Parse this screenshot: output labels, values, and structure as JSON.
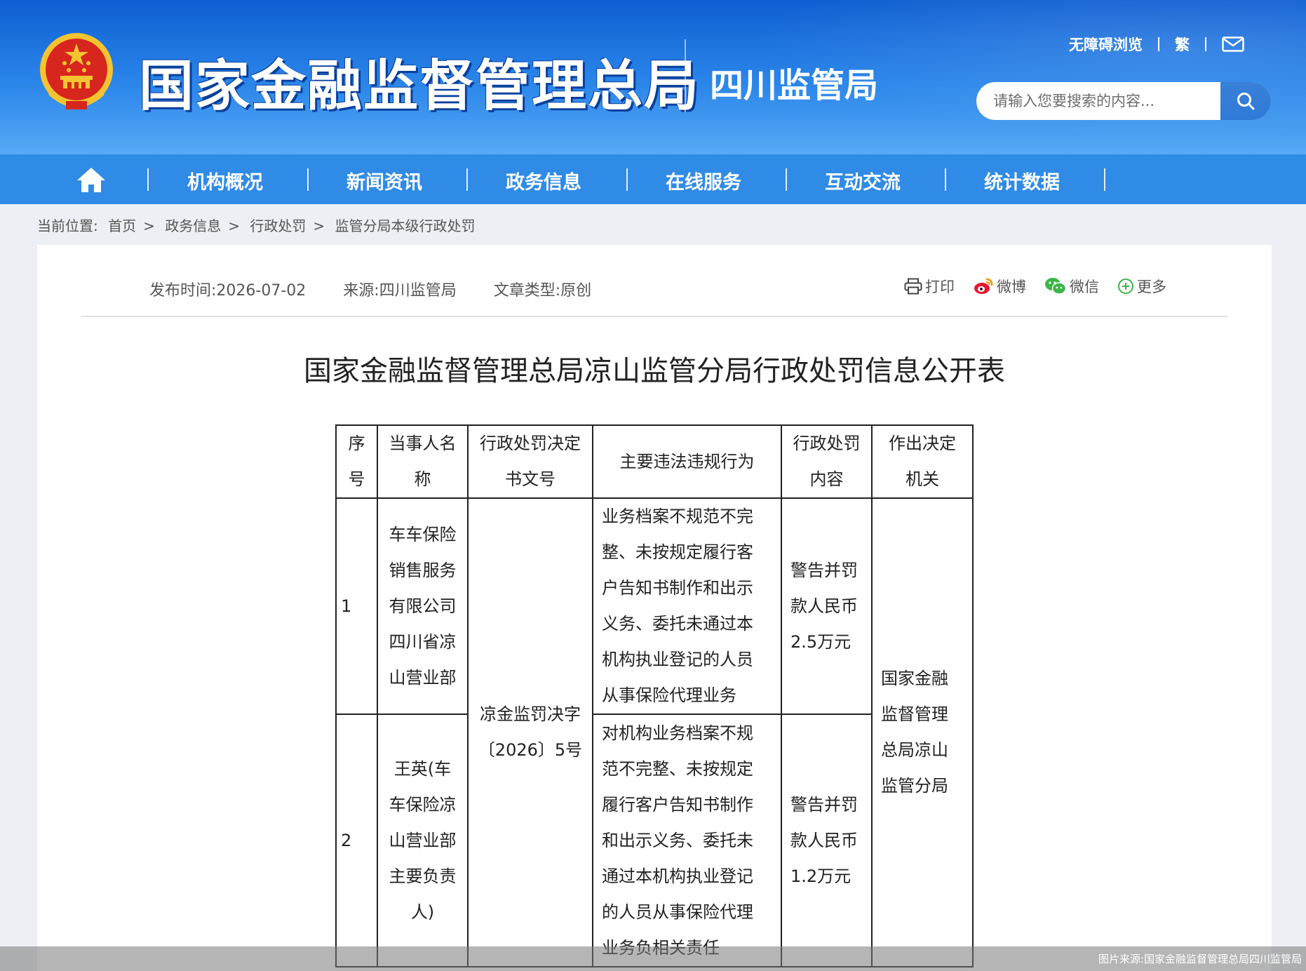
{
  "header": {
    "site_title": "国家金融监督管理总局",
    "sub_title": "四川监管局",
    "links": {
      "accessible": "无障碍浏览",
      "traditional": "繁"
    },
    "search": {
      "placeholder": "请输入您要搜索的内容..."
    },
    "colors": {
      "banner": "#1f74de",
      "nav": "#2f8be6"
    }
  },
  "nav": {
    "items": [
      "机构概况",
      "新闻资讯",
      "政务信息",
      "在线服务",
      "互动交流",
      "统计数据"
    ]
  },
  "breadcrumb": {
    "label": "当前位置:",
    "items": [
      "首页",
      "政务信息",
      "行政处罚",
      "监管分局本级行政处罚"
    ],
    "separator": ">"
  },
  "article": {
    "meta": {
      "publish": "发布时间:2026-07-02",
      "source": "来源:四川监管局",
      "type": "文章类型:原创"
    },
    "share": {
      "print": "打印",
      "weibo": "微博",
      "wechat": "微信",
      "more": "更多"
    },
    "title": "国家金融监督管理总局凉山监管分局行政处罚信息公开表"
  },
  "table": {
    "headers": {
      "no": [
        "序",
        "号"
      ],
      "party": [
        "当事人名",
        "称"
      ],
      "doc": [
        "行政处罚决定",
        "书文号"
      ],
      "violation": [
        "主要违法违规行为"
      ],
      "penalty": [
        "行政处罚",
        "内容"
      ],
      "authority": [
        "作出决定",
        "机关"
      ]
    },
    "doc_number": [
      "凉金监罚决字",
      "〔2026〕5号"
    ],
    "authority": [
      "国家金融",
      "监督管理",
      "总局凉山",
      "监管分局"
    ],
    "rows": [
      {
        "no": "1",
        "party": [
          "车车保险",
          "销售服务",
          "有限公司",
          "四川省凉",
          "山营业部"
        ],
        "violation": [
          "业务档案不规范不完",
          "整、未按规定履行客",
          "户告知书制作和出示",
          "义务、委托未通过本",
          "机构执业登记的人员",
          "从事保险代理业务"
        ],
        "penalty": [
          "警告并罚",
          "款人民币",
          "2.5万元"
        ]
      },
      {
        "no": "2",
        "party": [
          "王英(车",
          "车保险凉",
          "山营业部",
          "主要负责",
          "人)"
        ],
        "violation": [
          "对机构业务档案不规",
          "范不完整、未按规定",
          "履行客户告知书制作",
          "和出示义务、委托未",
          "通过本机构执业登记",
          "的人员从事保险代理",
          "业务负相关责任"
        ],
        "penalty": [
          "警告并罚",
          "款人民币",
          "1.2万元"
        ]
      }
    ]
  },
  "watermark": "图片来源:国家金融监督管理总局四川监管局"
}
